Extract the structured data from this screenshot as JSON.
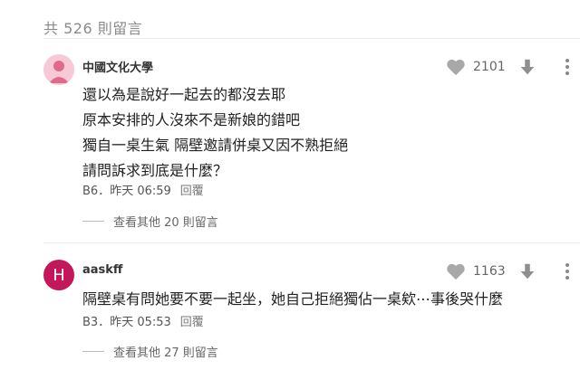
{
  "header": {
    "count_text": "共 526 則留言"
  },
  "comments": [
    {
      "author": "中國文化大學",
      "likes": "2101",
      "lines": [
        "還以為是說好一起去的都沒去耶",
        "原本安排的人沒來不是新娘的錯吧",
        "獨自一桌生氣 隔壁邀請併桌又因不熟拒絕",
        "請問訴求到底是什麼？"
      ],
      "floor_time": "B6．昨天 06:59",
      "reply_label": "回覆",
      "more_replies": "查看其他 20 則留言"
    },
    {
      "author": "aaskff",
      "avatar_letter": "H",
      "likes": "1163",
      "lines": [
        "隔壁桌有問她要不要一起坐，她自己拒絕獨佔一桌欸⋯事後哭什麼"
      ],
      "floor_time": "B3．昨天 05:53",
      "reply_label": "回覆",
      "more_replies": "查看其他 27 則留言"
    }
  ],
  "icons": {
    "like": "heart-icon",
    "dislike": "arrow-down-icon",
    "menu": "more-vertical-icon",
    "avatar1": "school-avatar-icon"
  },
  "colors": {
    "heart": "#a8a8a8",
    "avatar_letter_bg": "#c2185b",
    "avatar_school_bg": "#f7c9d6"
  }
}
